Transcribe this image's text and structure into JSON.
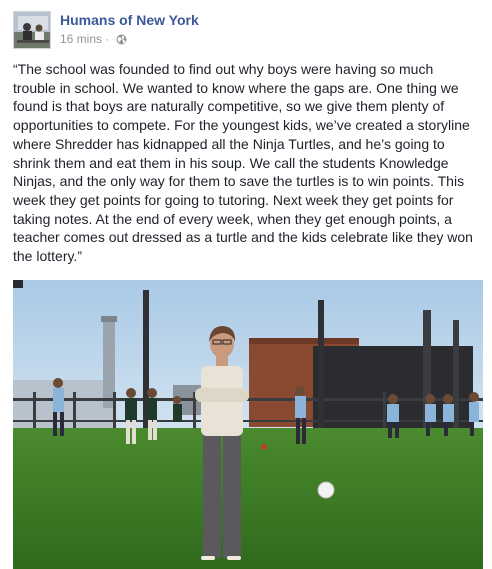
{
  "post": {
    "page_name": "Humans of New York",
    "timestamp": "16 mins",
    "separator": "·",
    "privacy_icon": "globe-icon",
    "caption": "“The school was founded to find out why boys were having so much trouble in school. We wanted to know where the gaps are. One thing we found is that boys are naturally competitive, so we give them plenty of opportunities to compete. For the youngest kids, we’ve created a storyline where Shredder has kidnapped all the Ninja Turtles, and he’s going to shrink them and eat them in his soup. We call the students Knowledge Ninjas, and the only way for them to save the turtles is to win points. This week they get points for going to tutoring. Next week they get points for taking notes. At the end of every week, when they get enough points, a teacher comes out dressed as a turtle and the kids celebrate like they won the lottery.”"
  },
  "colors": {
    "page_name": "#3b5998",
    "meta": "#90949c",
    "text": "#1d2129"
  }
}
